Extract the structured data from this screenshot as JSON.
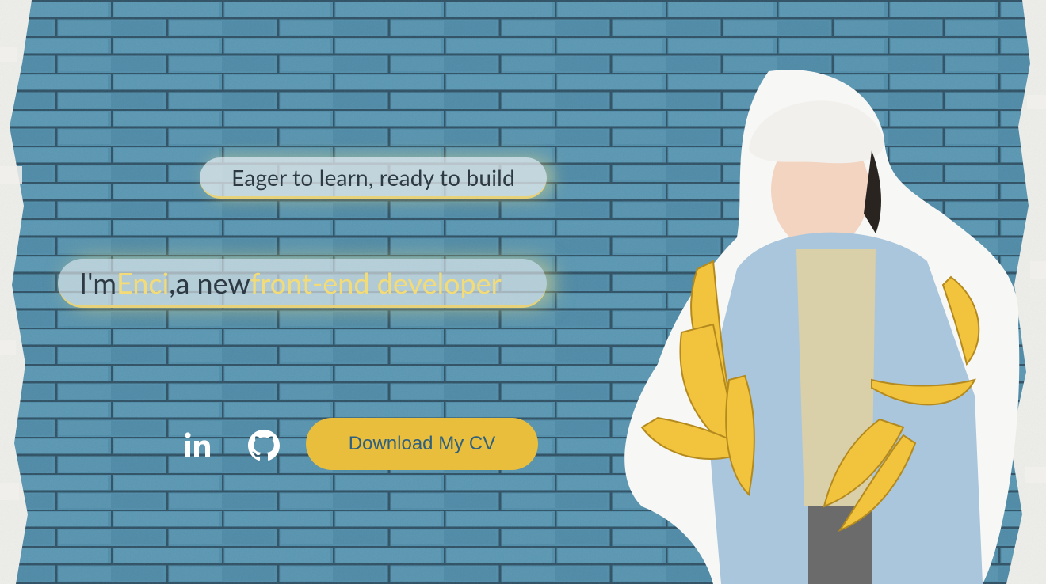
{
  "hero": {
    "tagline": "Eager to learn, ready to build",
    "intro": {
      "prefix": "I'm ",
      "name": "Enci",
      "middle": ",a new ",
      "role": "front-end developer"
    },
    "cv_button_label": "Download My CV"
  },
  "social": {
    "linkedin_icon": "linkedin-icon",
    "github_icon": "github-icon"
  },
  "colors": {
    "wall_blue": "#4d8ba8",
    "accent_yellow": "#f3dc78",
    "button_yellow": "#e9be3c",
    "button_text": "#2f6080",
    "text_dark": "#2d3a44"
  }
}
